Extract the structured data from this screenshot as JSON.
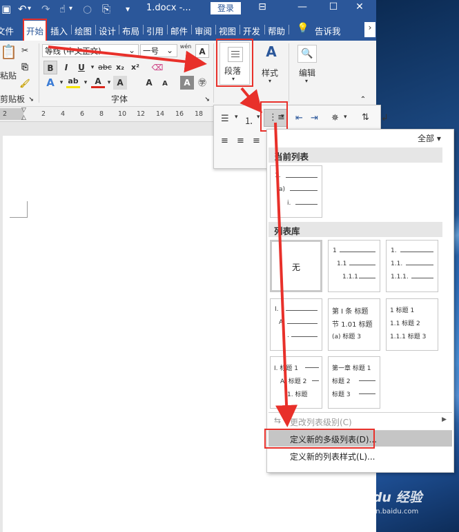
{
  "titlebar": {
    "doc_title": "1.docx  -...",
    "login_label": "登录",
    "undo_icon": "↶",
    "redo_icon": "↷",
    "touch_icon": "☝",
    "quick_icon": "▾",
    "restore_icon": "⊟",
    "minimize_icon": "—",
    "maximize_icon": "☐",
    "close_icon": "✕"
  },
  "tabs": [
    "文件",
    "开始",
    "插入",
    "绘图",
    "设计",
    "布局",
    "引用",
    "邮件",
    "审阅",
    "视图",
    "开发",
    "帮助",
    "告诉我"
  ],
  "ribbon": {
    "clipboard": {
      "paste": "粘贴",
      "group": "剪贴板"
    },
    "font": {
      "font_name": "等线 (中文正文)",
      "font_size": "一号",
      "phonetic": "wén",
      "group": "字体",
      "bold": "B",
      "italic": "I",
      "underline": "U",
      "strike": "abc",
      "sub": "x₂",
      "sup": "x²",
      "grow": "A",
      "shrink": "A"
    },
    "paragraph": {
      "label": "段落"
    },
    "styles": {
      "label": "样式"
    },
    "editing": {
      "label": "编辑"
    }
  },
  "ruler_ticks": [
    "2",
    "2",
    "4",
    "6",
    "8",
    "10",
    "12",
    "14",
    "16",
    "18"
  ],
  "dropdown": {
    "filter_label": "全部",
    "current_list_title": "当前列表",
    "current_list_markers": [
      "1.",
      "a)",
      "i."
    ],
    "library_title": "列表库",
    "library_none": "无",
    "cells": [
      [
        "1",
        "1.1",
        "1.1.1"
      ],
      [
        "1.",
        "1.1.",
        "1.1.1."
      ],
      [
        "I.",
        "A",
        "."
      ],
      [
        "第 I 条 标题",
        "节 1.01 标题",
        "(a) 标题 3"
      ],
      [
        "1 标题 1",
        "1.1 标题 2",
        "1.1.1 标题 3"
      ],
      [
        "I. 标题 1",
        "A. 标题 2",
        "1. 标题"
      ],
      [
        "第一章 标题 1",
        "标题 2",
        "标题 3"
      ]
    ],
    "change_level": "更改列表级别(C)",
    "define_multilevel": "定义新的多级列表(D)...",
    "define_style": "定义新的列表样式(L)..."
  },
  "watermark": {
    "brand": "Baidu 经验",
    "url": "jingyan.baidu.com"
  },
  "colors": {
    "word_blue": "#2b579a",
    "annotation_red": "#e8302a"
  }
}
